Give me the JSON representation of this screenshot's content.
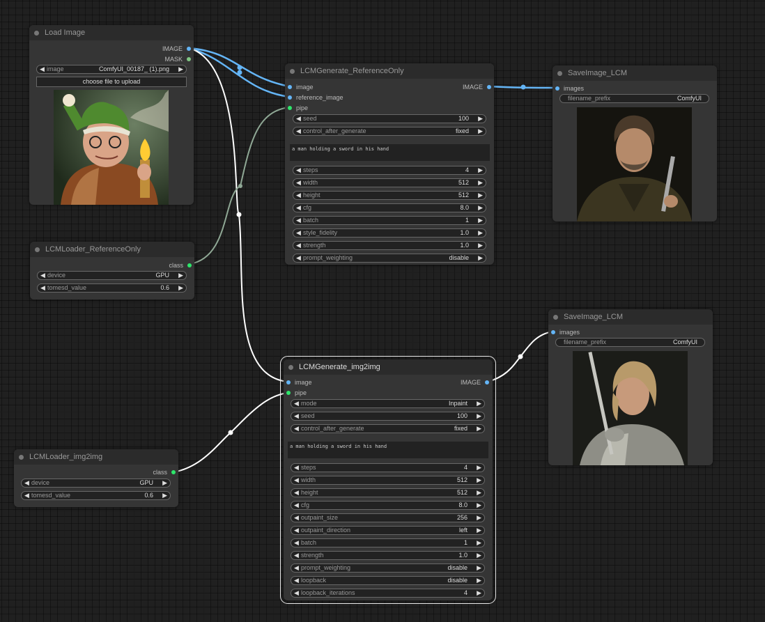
{
  "colors": {
    "canvas_bg": "#202020",
    "node_bg": "#353535",
    "node_title_bg": "#2b2b2b",
    "image_link": "#64b5f6",
    "model_link": "#ffffff",
    "class_link": "#8fa895",
    "image_slot": "#64b5f6",
    "mask_slot": "#81c784",
    "pipe_slot": "#2ee66b"
  },
  "nodes": {
    "load_image": {
      "title": "Load Image",
      "outputs": [
        "IMAGE",
        "MASK"
      ],
      "widgets": [
        {
          "label": "image",
          "value": "ComfyUI_00187_ (1).png"
        }
      ],
      "upload_button": "choose file to upload",
      "preview": "portrait-old-man-green-hat-holding-torch"
    },
    "lcm_loader_ref": {
      "title": "LCMLoader_ReferenceOnly",
      "outputs": [
        "class"
      ],
      "widgets": [
        {
          "label": "device",
          "value": "GPU"
        },
        {
          "label": "tomesd_value",
          "value": "0.6"
        }
      ]
    },
    "lcm_generate_ref": {
      "title": "LCMGenerate_ReferenceOnly",
      "inputs": [
        "image",
        "reference_image",
        "pipe"
      ],
      "outputs": [
        "IMAGE"
      ],
      "widgets_top": [
        {
          "label": "seed",
          "value": "100"
        },
        {
          "label": "control_after_generate",
          "value": "fixed"
        }
      ],
      "prompt": "a man holding a sword in his hand",
      "widgets_bottom": [
        {
          "label": "steps",
          "value": "4"
        },
        {
          "label": "width",
          "value": "512"
        },
        {
          "label": "height",
          "value": "512"
        },
        {
          "label": "cfg",
          "value": "8.0"
        },
        {
          "label": "batch",
          "value": "1"
        },
        {
          "label": "style_fidelity",
          "value": "1.0"
        },
        {
          "label": "strength",
          "value": "1.0"
        },
        {
          "label": "prompt_weighting",
          "value": "disable"
        }
      ]
    },
    "save_image_top": {
      "title": "SaveImage_LCM",
      "inputs": [
        "images"
      ],
      "widgets": [
        {
          "label": "filename_prefix",
          "value": "ComfyUI"
        }
      ],
      "preview": "portrait-bearded-man-in-leather-with-sword"
    },
    "lcm_generate_img2img": {
      "title": "LCMGenerate_img2img",
      "inputs": [
        "image",
        "pipe"
      ],
      "outputs": [
        "IMAGE"
      ],
      "widgets_top": [
        {
          "label": "mode",
          "value": "Inpaint"
        },
        {
          "label": "seed",
          "value": "100"
        },
        {
          "label": "control_after_generate",
          "value": "fixed"
        }
      ],
      "prompt": "a man holding a sword in his hand",
      "widgets_bottom": [
        {
          "label": "steps",
          "value": "4"
        },
        {
          "label": "width",
          "value": "512"
        },
        {
          "label": "height",
          "value": "512"
        },
        {
          "label": "cfg",
          "value": "8.0"
        },
        {
          "label": "outpaint_size",
          "value": "256"
        },
        {
          "label": "outpaint_direction",
          "value": "left"
        },
        {
          "label": "batch",
          "value": "1"
        },
        {
          "label": "strength",
          "value": "1.0"
        },
        {
          "label": "prompt_weighting",
          "value": "disable"
        },
        {
          "label": "loopback",
          "value": "disable"
        },
        {
          "label": "loopback_iterations",
          "value": "4"
        }
      ]
    },
    "save_image_bottom": {
      "title": "SaveImage_LCM",
      "inputs": [
        "images"
      ],
      "widgets": [
        {
          "label": "filename_prefix",
          "value": "ComfyUI"
        }
      ],
      "preview": "portrait-blond-knight-in-armor-with-sword"
    },
    "lcm_loader_img2img": {
      "title": "LCMLoader_img2img",
      "outputs": [
        "class"
      ],
      "widgets": [
        {
          "label": "device",
          "value": "GPU"
        },
        {
          "label": "tomesd_value",
          "value": "0.6"
        }
      ]
    }
  }
}
